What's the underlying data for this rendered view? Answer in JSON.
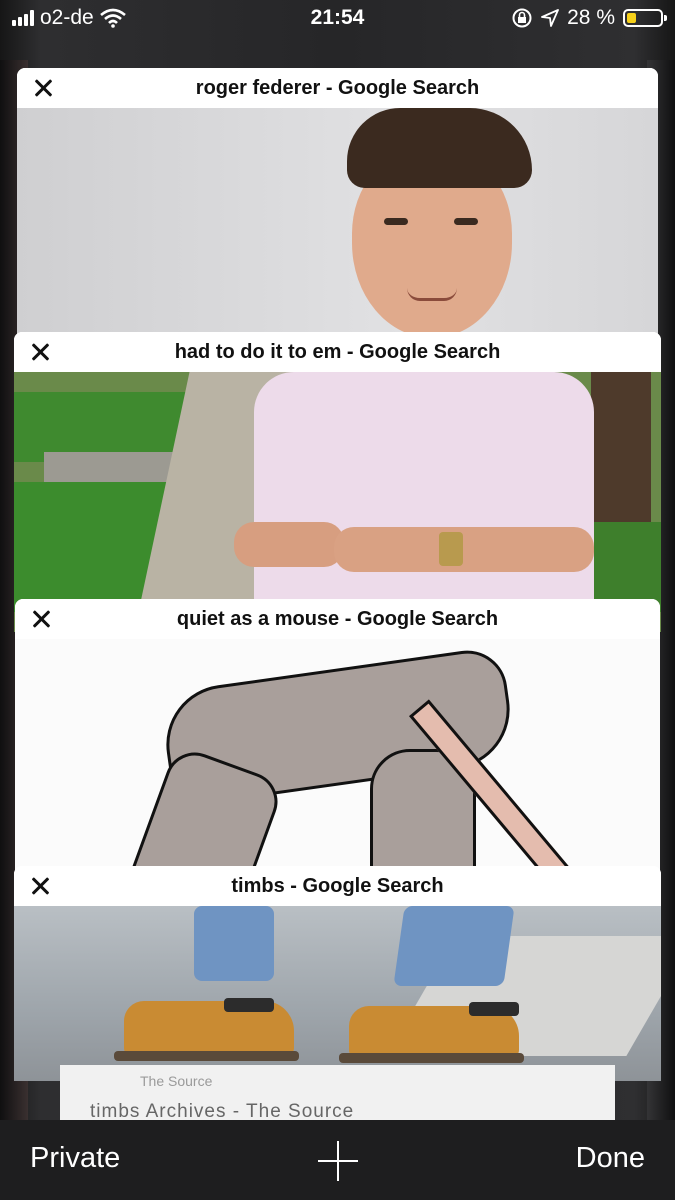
{
  "status_bar": {
    "carrier": "o2-de",
    "time": "21:54",
    "battery_percent_label": "28 %",
    "battery_level": 0.28,
    "icons": [
      "signal-bars-icon",
      "wifi-icon",
      "orientation-lock-icon",
      "location-arrow-icon",
      "battery-icon"
    ]
  },
  "tabs": [
    {
      "title": "roger federer - Google Search",
      "close_icon": "close-icon"
    },
    {
      "title": "had to do it to em - Google Search",
      "close_icon": "close-icon"
    },
    {
      "title": "quiet as a mouse - Google Search",
      "close_icon": "close-icon"
    },
    {
      "title": "timbs - Google Search",
      "close_icon": "close-icon"
    }
  ],
  "underlying_page": {
    "source_label": "The Source",
    "result_title": "timbs Archives - The Source"
  },
  "toolbar": {
    "private_label": "Private",
    "new_tab_icon": "plus-icon",
    "done_label": "Done"
  },
  "colors": {
    "battery_fill": "#f7d11a",
    "toolbar_bg": "#1e1e1f",
    "backdrop": "#262628"
  }
}
